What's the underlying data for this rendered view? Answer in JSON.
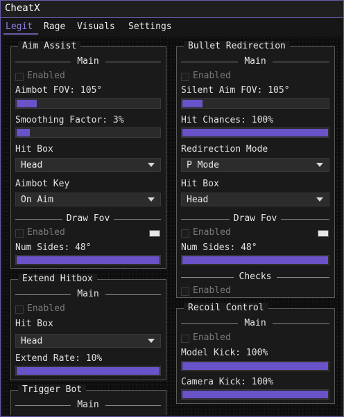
{
  "window": {
    "title": "CheatX"
  },
  "tabs": [
    "Legit",
    "Rage",
    "Visuals",
    "Settings"
  ],
  "aim_assist": {
    "title": "Aim Assist",
    "main_section": "Main",
    "enabled_label": "Enabled",
    "enabled": false,
    "fov_label": "Aimbot FOV: 105°",
    "fov_fraction": 0.14,
    "smoothing_label": "Smoothing Factor: 3%",
    "smoothing_fraction": 0.09,
    "hitbox_label": "Hit Box",
    "hitbox_value": "Head",
    "key_label": "Aimbot Key",
    "key_value": "On Aim",
    "drawfov_section": "Draw Fov",
    "drawfov_enabled_label": "Enabled",
    "drawfov_enabled": false,
    "num_sides_label": "Num Sides: 48°",
    "num_sides_fraction": 1.0
  },
  "extend_hitbox": {
    "title": "Extend Hitbox",
    "main_section": "Main",
    "enabled_label": "Enabled",
    "enabled": false,
    "hitbox_label": "Hit Box",
    "hitbox_value": "Head",
    "rate_label": "Extend Rate: 10%",
    "rate_fraction": 1.0
  },
  "trigger_bot": {
    "title": "Trigger Bot",
    "main_section": "Main"
  },
  "bullet_redirection": {
    "title": "Bullet Redirection",
    "main_section": "Main",
    "enabled_label": "Enabled",
    "enabled": false,
    "silent_fov_label": "Silent Aim FOV: 105°",
    "silent_fov_fraction": 0.14,
    "hit_chances_label": "Hit Chances: 100%",
    "hit_chances_fraction": 1.0,
    "mode_label": "Redirection Mode",
    "mode_value": "P Mode",
    "hitbox_label": "Hit Box",
    "hitbox_value": "Head",
    "drawfov_section": "Draw Fov",
    "drawfov_enabled_label": "Enabled",
    "drawfov_enabled": false,
    "num_sides_label": "Num Sides: 48°",
    "num_sides_fraction": 1.0,
    "checks_section": "Checks",
    "checks_enabled_label": "Enabled",
    "checks_enabled": false
  },
  "recoil_control": {
    "title": "Recoil Control",
    "main_section": "Main",
    "enabled_label": "Enabled",
    "enabled": false,
    "model_kick_label": "Model Kick: 100%",
    "model_kick_fraction": 1.0,
    "camera_kick_label": "Camera Kick: 100%",
    "camera_kick_fraction": 1.0
  },
  "colors": {
    "accent": "#6a52c8",
    "tab_active": "#8f7fe6",
    "border": "#6a5aa8"
  },
  "icons": {
    "dropdown": "chevron-down-icon"
  }
}
